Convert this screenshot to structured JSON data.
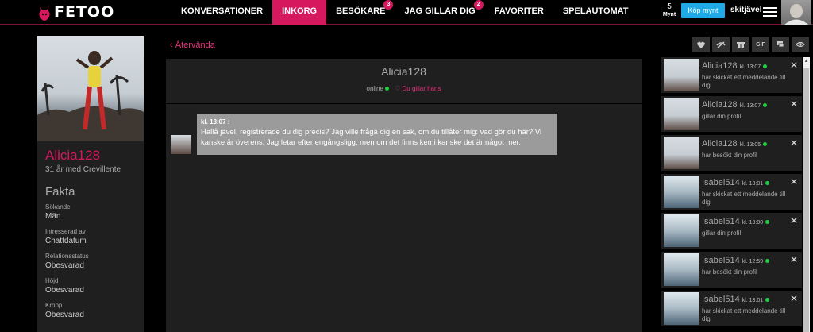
{
  "brand": {
    "logo_text": "FETOO"
  },
  "nav": {
    "items": [
      {
        "label": "KONVERSATIONER",
        "badge": ""
      },
      {
        "label": "INKORG",
        "badge": ""
      },
      {
        "label": "BESÖKARE",
        "badge": "3"
      },
      {
        "label": "JAG GILLAR DIG",
        "badge": "2"
      },
      {
        "label": "FAVORITER",
        "badge": ""
      },
      {
        "label": "SPELAUTOMAT",
        "badge": ""
      }
    ],
    "active_index": 1
  },
  "account": {
    "coins_count": "5",
    "coins_label": "Mynt",
    "buy_label": "Köp mynt",
    "username": "skitjävel"
  },
  "profile": {
    "name": "Alicia128",
    "subtitle": "31 år med Crevillente",
    "facts_title": "Fakta",
    "facts": [
      {
        "label": "Sökande",
        "value": "Män"
      },
      {
        "label": "Intresserad av",
        "value": "Chattdatum"
      },
      {
        "label": "Relationsstatus",
        "value": "Obesvarad"
      },
      {
        "label": "Höjd",
        "value": "Obesvarad"
      },
      {
        "label": "Kropp",
        "value": "Obesvarad"
      }
    ]
  },
  "back_label": "Återvända",
  "chat": {
    "title": "Alicia128",
    "status": "online",
    "likes_label": "Du gillar hans",
    "message": {
      "time": "kl. 13:07 :",
      "text": "Hallå jävel, registrerade du dig precis? Jag ville fråga dig en sak, om du tillåter mig: vad gör du här? Vi kanske är överens. Jag letar efter engångsligg, men om det finns kemi kanske det är något mer."
    }
  },
  "toolbar": {
    "icons": [
      "heart-icon",
      "hide-icon",
      "gift-icon",
      "gif-icon",
      "chat-icon",
      "eye-icon"
    ],
    "gif_label": "GIF"
  },
  "notifications": [
    {
      "name": "Alicia128",
      "time": "kl. 13:07",
      "text": "har skickat ett meddelande till dig",
      "photo": "a"
    },
    {
      "name": "Alicia128",
      "time": "kl. 13:07",
      "text": "gillar din profil",
      "photo": "a"
    },
    {
      "name": "Alicia128",
      "time": "kl. 13:05",
      "text": "har besökt din profil",
      "photo": "a"
    },
    {
      "name": "Isabel514",
      "time": "kl. 13:01",
      "text": "har skickat ett meddelande till dig",
      "photo": "b"
    },
    {
      "name": "Isabel514",
      "time": "kl. 13:00",
      "text": "gillar din profil",
      "photo": "b"
    },
    {
      "name": "Isabel514",
      "time": "kl. 12:59",
      "text": "har besökt din profil",
      "photo": "b"
    },
    {
      "name": "Isabel514",
      "time": "kl. 13:01",
      "text": "har skickat ett meddelande till dig",
      "photo": "b"
    }
  ],
  "colors": {
    "accent": "#d6195f",
    "buy": "#1fa9e6",
    "online": "#1fcf3f"
  }
}
